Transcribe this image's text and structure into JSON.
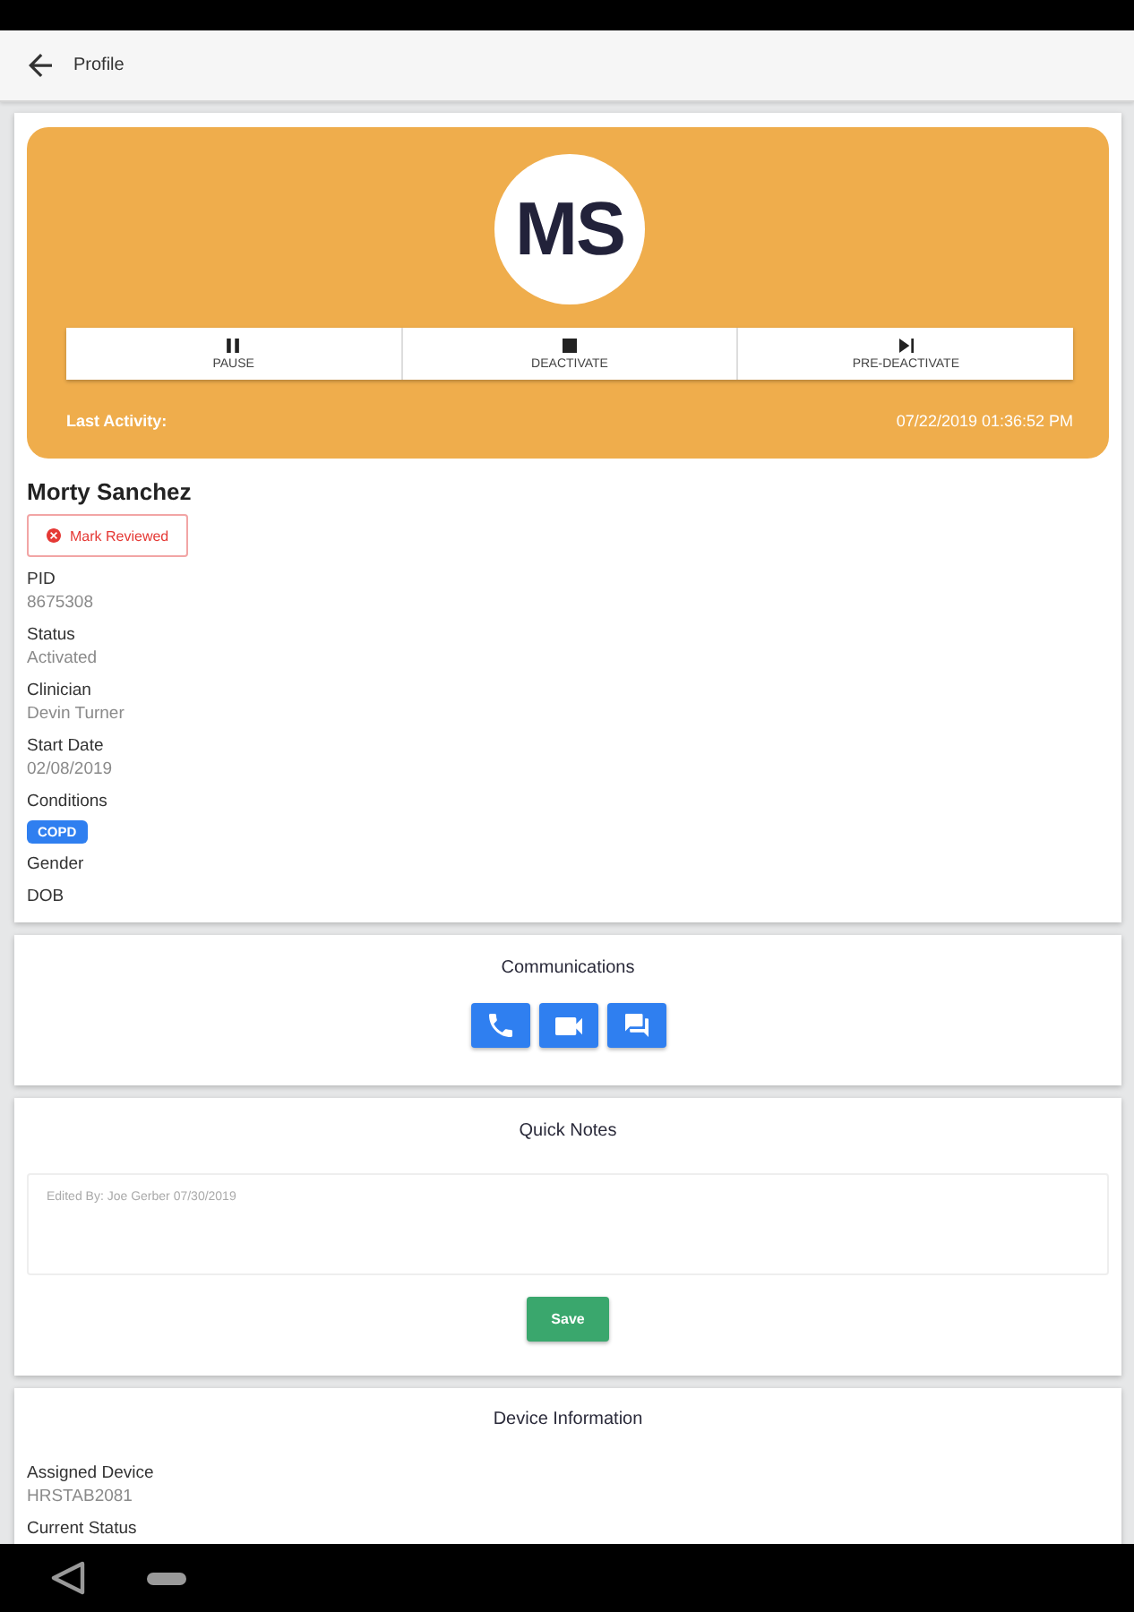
{
  "app_bar": {
    "title": "Profile"
  },
  "profile": {
    "initials": "MS",
    "actions": [
      {
        "kind": "pause",
        "label": "PAUSE"
      },
      {
        "kind": "stop",
        "label": "DEACTIVATE"
      },
      {
        "kind": "skip-next",
        "label": "PRE-DEACTIVATE"
      }
    ],
    "last_activity": {
      "label": "Last Activity:",
      "value": "07/22/2019 01:36:52 PM"
    },
    "name": "Morty Sanchez",
    "review_button": "Mark Reviewed",
    "fields": [
      {
        "label": "PID",
        "value": "8675308"
      },
      {
        "label": "Status",
        "value": "Activated"
      },
      {
        "label": "Clinician",
        "value": "Devin Turner"
      },
      {
        "label": "Start Date",
        "value": "02/08/2019"
      },
      {
        "label": "Conditions",
        "tags": [
          "COPD"
        ]
      },
      {
        "label": "Gender"
      },
      {
        "label": "DOB"
      }
    ]
  },
  "communications": {
    "title": "Communications",
    "buttons": [
      {
        "kind": "phone"
      },
      {
        "kind": "video"
      },
      {
        "kind": "chat"
      }
    ]
  },
  "quick_notes": {
    "title": "Quick Notes",
    "placeholder": "Edited By: Joe Gerber 07/30/2019",
    "save_button": "Save"
  },
  "device_information": {
    "title": "Device Information",
    "fields": [
      {
        "label": "Assigned Device",
        "value": "HRSTAB2081"
      },
      {
        "label": "Current Status"
      }
    ]
  }
}
